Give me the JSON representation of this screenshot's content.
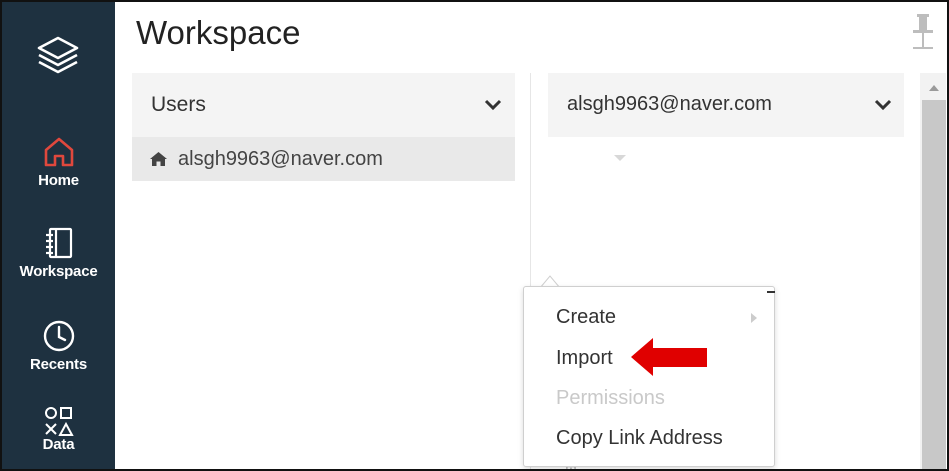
{
  "app": {
    "title": "Workspace"
  },
  "nav": {
    "items": [
      {
        "label": "Home",
        "icon": "home-icon",
        "color": "#e0483d"
      },
      {
        "label": "Workspace",
        "icon": "notebook-icon"
      },
      {
        "label": "Recents",
        "icon": "clock-icon"
      },
      {
        "label": "Data",
        "icon": "shapes-icon"
      }
    ]
  },
  "users_column": {
    "header": "Users",
    "selected_user": "alsgh9963@naver.com"
  },
  "folder_column": {
    "header": "alsgh9963@naver.com"
  },
  "context_menu": {
    "items": [
      {
        "label": "Create",
        "has_submenu": true,
        "enabled": true
      },
      {
        "label": "Import",
        "enabled": true,
        "highlighted_by_arrow": true
      },
      {
        "label": "Permissions",
        "enabled": false
      },
      {
        "label": "Copy Link Address",
        "enabled": true
      }
    ]
  },
  "colors": {
    "nav_bg": "#1e3140",
    "accent_red": "#e0483d",
    "arrow_red": "#e00000"
  }
}
